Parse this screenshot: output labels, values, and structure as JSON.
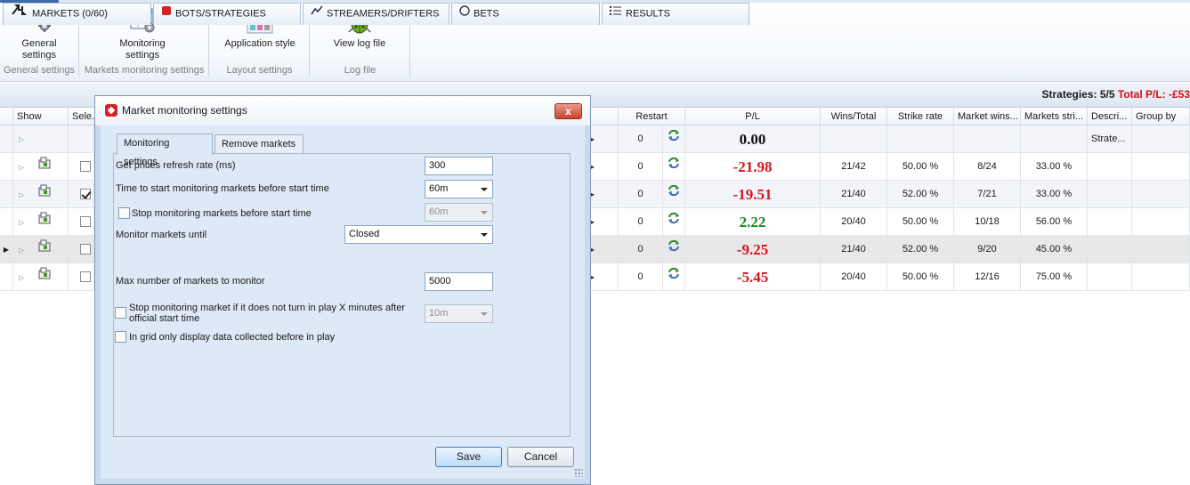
{
  "ribbon": {
    "groups": [
      {
        "caption": "General settings",
        "buttons": [
          {
            "label_line1": "General",
            "label_line2": "settings",
            "icon": "gears-icon"
          }
        ]
      },
      {
        "caption": "Markets monitoring settings",
        "buttons": [
          {
            "label_line1": "Monitoring",
            "label_line2": "settings",
            "icon": "monitoring-settings-icon"
          }
        ]
      },
      {
        "caption": "Layout settings",
        "buttons": [
          {
            "label_line1": "Application style",
            "label_line2": "",
            "icon": "color-palette-icon"
          }
        ]
      },
      {
        "caption": "Log file",
        "buttons": [
          {
            "label_line1": "View log file",
            "label_line2": "",
            "icon": "bug-icon"
          }
        ]
      }
    ]
  },
  "tabs": [
    {
      "label": "MARKETS (0/60)",
      "icon": "markets-arrows-icon"
    },
    {
      "label": "BOTS/STRATEGIES",
      "icon": "bots-icon"
    },
    {
      "label": "STREAMERS/DRIFTERS",
      "icon": "streamers-icon"
    },
    {
      "label": "BETS",
      "icon": "bets-icon"
    },
    {
      "label": "RESULTS",
      "icon": "results-list-icon"
    }
  ],
  "summary": {
    "strategies": "Strategies: 5/5",
    "total_pl": "Total P/L: -£53"
  },
  "grid": {
    "columns": {
      "show": "Show",
      "select": "Sele...",
      "restart": "Restart",
      "pl": "P/L",
      "wins_total": "Wins/Total",
      "strike_rate": "Strike rate",
      "market_wins": "Market wins...",
      "markets_strike": "Markets stri...",
      "description": "Descri...",
      "group_by": "Group by"
    },
    "rows": [
      {
        "restart": "0",
        "pl": "0.00",
        "sign": "zero",
        "wins_total": "",
        "strike_rate": "",
        "market_wins": "",
        "markets_strike": "",
        "description": "Strate...",
        "checked": false,
        "summary": true
      },
      {
        "restart": "0",
        "pl": "-21.98",
        "sign": "neg",
        "wins_total": "21/42",
        "strike_rate": "50.00 %",
        "market_wins": "8/24",
        "markets_strike": "33.00 %",
        "description": "",
        "checked": false
      },
      {
        "restart": "0",
        "pl": "-19.51",
        "sign": "neg",
        "wins_total": "21/40",
        "strike_rate": "52.00 %",
        "market_wins": "7/21",
        "markets_strike": "33.00 %",
        "description": "",
        "checked": true
      },
      {
        "restart": "0",
        "pl": "2.22",
        "sign": "pos",
        "wins_total": "20/40",
        "strike_rate": "50.00 %",
        "market_wins": "10/18",
        "markets_strike": "56.00 %",
        "description": "",
        "checked": false
      },
      {
        "restart": "0",
        "pl": "-9.25",
        "sign": "neg",
        "wins_total": "21/40",
        "strike_rate": "52.00 %",
        "market_wins": "9/20",
        "markets_strike": "45.00 %",
        "description": "",
        "checked": false,
        "selected": true
      },
      {
        "restart": "0",
        "pl": "-5.45",
        "sign": "neg",
        "wins_total": "20/40",
        "strike_rate": "50.00 %",
        "market_wins": "12/16",
        "markets_strike": "75.00 %",
        "description": "",
        "checked": false
      }
    ]
  },
  "dialog": {
    "title": "Market monitoring settings",
    "close": "x",
    "tabs": {
      "monitoring": "Monitoring settings",
      "remove": "Remove markets"
    },
    "fields": {
      "refresh_label": "Get prices refresh rate (ms)",
      "refresh_value": "300",
      "start_label": "Time to start monitoring markets before start time",
      "start_value": "60m",
      "stop_label": "Stop monitoring markets before start time",
      "stop_value": "60m",
      "until_label": "Monitor markets until",
      "until_value": "Closed",
      "max_label": "Max number of markets to monitor",
      "max_value": "5000",
      "inplay_label_line1": "Stop monitoring market if it does not turn in play X minutes after",
      "inplay_label_line2": "official start time",
      "inplay_value": "10m",
      "grid_only_label": "In grid only display data collected before in play"
    },
    "buttons": {
      "save": "Save",
      "cancel": "Cancel"
    }
  }
}
